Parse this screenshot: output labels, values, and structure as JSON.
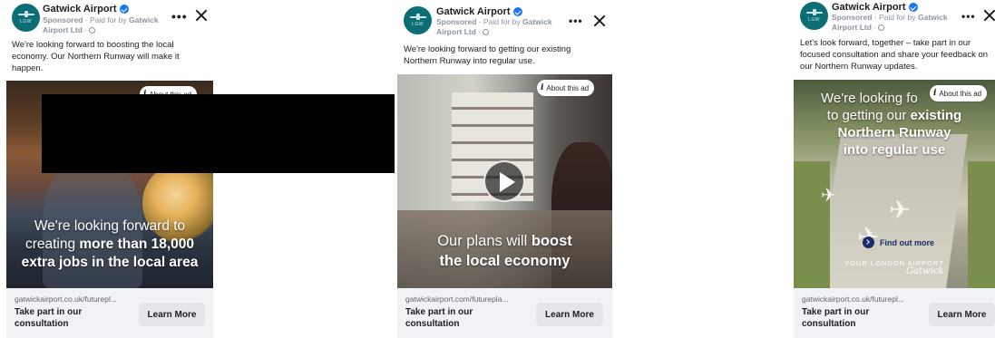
{
  "ads": [
    {
      "page_name": "Gatwick Airport",
      "sponsored": "Sponsored",
      "paid_prefix": "Paid for by",
      "paid_by": "Gatwick Airport Ltd",
      "avatar_text": "LGW",
      "text": "We're looking forward to boosting the local economy. Our Northern Runway will make it happen.",
      "about_label": "About this ad",
      "overlay_line1": "We're looking forward to",
      "overlay_line2_plain": "creating ",
      "overlay_line2_bold": "more than 18,000",
      "overlay_line3": "extra jobs in the local area",
      "url": "gatwickairport.co.uk/futurepl...",
      "cta_title": "Take part in our consultation",
      "cta_button": "Learn More"
    },
    {
      "page_name": "Gatwick Airport",
      "sponsored": "Sponsored",
      "paid_prefix": "Paid for by",
      "paid_by": "Gatwick Airport Ltd",
      "avatar_text": "LGW",
      "text": "We're looking forward to getting our existing Northern Runway into regular use.",
      "about_label": "About this ad",
      "overlay_line1_plain": "Our plans will ",
      "overlay_line1_bold": "boost",
      "overlay_line2": "the local economy",
      "url": "gatwickairport.com/futurepla...",
      "cta_title": "Take part in our consultation",
      "cta_button": "Learn More"
    },
    {
      "page_name": "Gatwick Airport",
      "sponsored": "Sponsored",
      "paid_prefix": "Paid for by",
      "paid_by": "Gatwick Airport Ltd",
      "avatar_text": "LGW",
      "text": "Let's look forward, together – take part in our focused consultation and share your feedback on our Northern Runway updates.",
      "about_label": "About this ad",
      "overlay_line1": "We're looking fo",
      "overlay_line2_plain": "to getting our ",
      "overlay_line2_bold": "existing",
      "overlay_line3": "Northern Runway",
      "overlay_line4": "into regular use",
      "find_out": "Find out more",
      "brand_tag": "YOUR LONDON AIRPORT",
      "brand_name": "Gatwick",
      "url": "gatwickairport.co.uk/futurepl...",
      "cta_title": "Take part in our consultation",
      "cta_button": "Learn More"
    }
  ],
  "colors": {
    "verified": "#1877f2",
    "brand_teal": "#0b6e74",
    "footer_bg": "#f0f2f5",
    "button_bg": "#e4e6eb",
    "gatwick_navy": "#1b2a6b"
  }
}
